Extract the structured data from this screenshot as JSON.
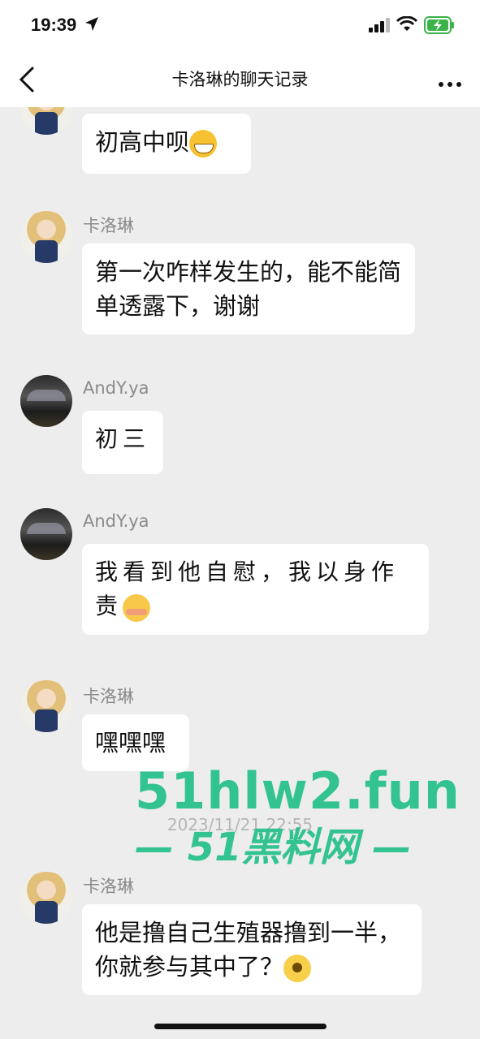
{
  "status": {
    "time": "19:39"
  },
  "nav": {
    "title": "卡洛琳的聊天记录"
  },
  "messages": [
    {
      "sender": "",
      "text": "初高中呗",
      "emoji": "grin-emoji"
    },
    {
      "sender": "卡洛琳",
      "text": "第一次咋样发生的，能不能简单透露下，谢谢"
    },
    {
      "sender": "AndY.ya",
      "text": "初三"
    },
    {
      "sender": "AndY.ya",
      "text": "我看到他自慰，我以身作责",
      "emoji": "shy-emoji"
    },
    {
      "sender": "卡洛琳",
      "text": "嘿嘿嘿"
    },
    {
      "sender": "卡洛琳",
      "text": "他是撸自己生殖器撸到一半，你就参与其中了？",
      "emoji": "flushed-emoji"
    }
  ],
  "timestamp": "2023/11/21 22:55",
  "watermark": {
    "line1": "51hlw2.fun",
    "line2": "— 51黑料网 —"
  },
  "colors": {
    "bubble": "#ffffff",
    "background": "#ededed",
    "watermark": "#23c089"
  }
}
